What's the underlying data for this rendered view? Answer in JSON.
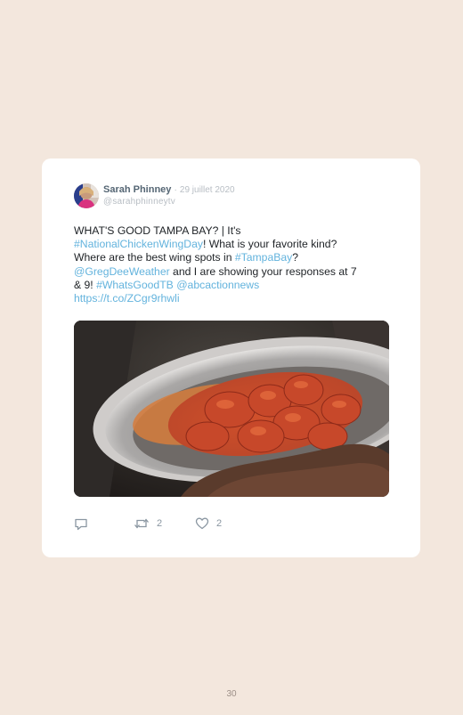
{
  "tweet": {
    "author_name": "Sarah Phinney",
    "separator": "·",
    "date": "29 juillet 2020",
    "handle": "@sarahphinneytv",
    "text": {
      "l1_a": "WHAT'S GOOD TAMPA BAY? | It's",
      "l2_link": "#NationalChickenWingDay",
      "l2_b": "! What is your favorite kind?",
      "l3_a": "Where are the best wing spots in ",
      "l3_link": "#TampaBay",
      "l3_b": "?",
      "l4_link": "@GregDeeWeather",
      "l4_b": " and I are showing your responses at 7",
      "l5_a": "& 9! ",
      "l5_link1": "#WhatsGoodTB",
      "l5_sp": " ",
      "l5_link2": "@abcactionnews",
      "l6_link": "https://t.co/ZCgr9rhwli"
    },
    "actions": {
      "reply_icon": "reply-icon",
      "retweet_icon": "retweet-icon",
      "retweet_count": "2",
      "like_icon": "heart-icon",
      "like_count": "2"
    }
  },
  "colors": {
    "page_background": "#f3e7dd",
    "card_background": "#ffffff",
    "link": "#63b3dd",
    "muted": "#b8bec4"
  },
  "page_number": "30"
}
